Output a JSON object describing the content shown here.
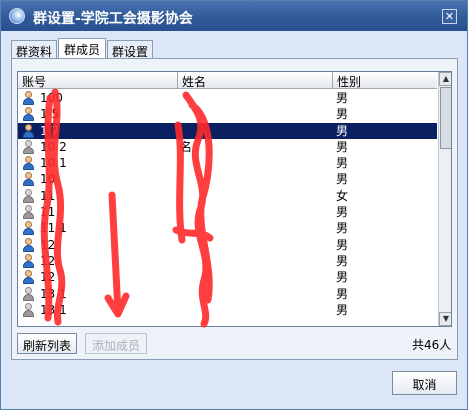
{
  "window": {
    "title": "群设置-学院工会摄影协会",
    "close_glyph": "✕"
  },
  "tabs": [
    {
      "label": "群资料"
    },
    {
      "label": "群成员"
    },
    {
      "label": "群设置"
    }
  ],
  "members_table": {
    "columns": [
      "账号",
      "姓名",
      "性别"
    ],
    "rows": [
      {
        "account": "100",
        "name": "",
        "gender": "男",
        "online": true,
        "selected": false
      },
      {
        "account": "1 5",
        "name": "",
        "gender": "男",
        "online": true,
        "selected": false
      },
      {
        "account": "1 7",
        "name": "",
        "gender": "男",
        "online": true,
        "selected": true
      },
      {
        "account": "10 2",
        "name": "名",
        "gender": "男",
        "online": false,
        "selected": false
      },
      {
        "account": "10 1",
        "name": "",
        "gender": "男",
        "online": true,
        "selected": false
      },
      {
        "account": "10",
        "name": "",
        "gender": "男",
        "online": true,
        "selected": false
      },
      {
        "account": "11",
        "name": "",
        "gender": "女",
        "online": false,
        "selected": false
      },
      {
        "account": "11",
        "name": "",
        "gender": "男",
        "online": false,
        "selected": false
      },
      {
        "account": "11 1",
        "name": "",
        "gender": "男",
        "online": true,
        "selected": false
      },
      {
        "account": "12",
        "name": "",
        "gender": "男",
        "online": true,
        "selected": false
      },
      {
        "account": "12",
        "name": "",
        "gender": "男",
        "online": true,
        "selected": false
      },
      {
        "account": "12",
        "name": "",
        "gender": "男",
        "online": true,
        "selected": false
      },
      {
        "account": "13 1",
        "name": "",
        "gender": "男",
        "online": false,
        "selected": false
      },
      {
        "account": "13 1",
        "name": "",
        "gender": "男",
        "online": false,
        "selected": false
      }
    ]
  },
  "scrollbar": {
    "up_glyph": "▲",
    "down_glyph": "▼"
  },
  "footer": {
    "refresh_label": "刷新列表",
    "add_member_label": "添加成员",
    "member_count": "共46人"
  },
  "cancel_label": "取消",
  "colors": {
    "annotation": "#ff2a2a",
    "selection": "#0b2060",
    "title_bar": "#2f5997"
  }
}
